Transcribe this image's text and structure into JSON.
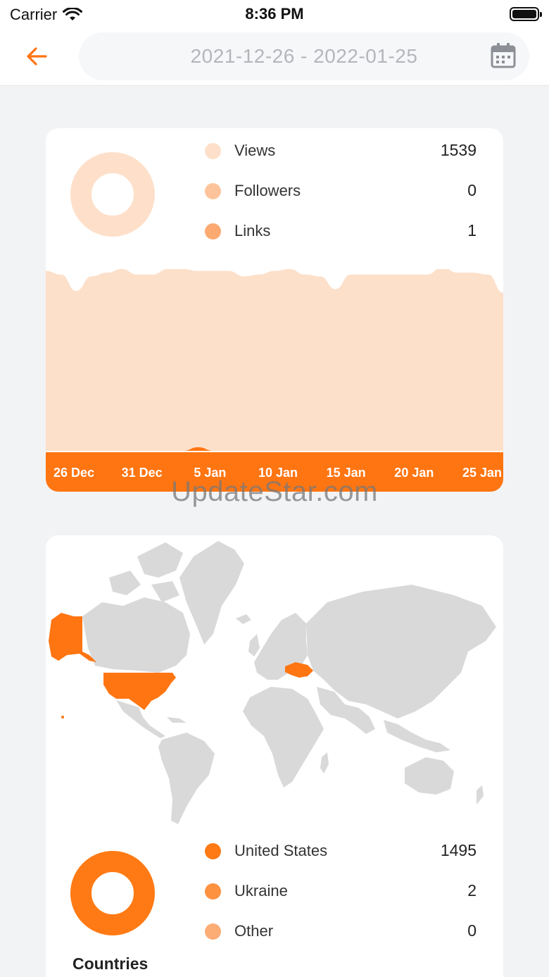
{
  "status_bar": {
    "carrier": "Carrier",
    "time": "8:36 PM"
  },
  "header": {
    "date_range": "2021-12-26 - 2022-01-25"
  },
  "stats": [
    {
      "label": "Views",
      "value": "1539",
      "color": "#fee0ca"
    },
    {
      "label": "Followers",
      "value": "0",
      "color": "#fdc49b"
    },
    {
      "label": "Links",
      "value": "1",
      "color": "#fcaa72"
    }
  ],
  "chart_data": {
    "type": "area",
    "x": [
      "26 Dec",
      "27 Dec",
      "28 Dec",
      "29 Dec",
      "30 Dec",
      "31 Dec",
      "1 Jan",
      "2 Jan",
      "3 Jan",
      "4 Jan",
      "5 Jan",
      "6 Jan",
      "7 Jan",
      "8 Jan",
      "9 Jan",
      "10 Jan",
      "11 Jan",
      "12 Jan",
      "13 Jan",
      "14 Jan",
      "15 Jan",
      "16 Jan",
      "17 Jan",
      "18 Jan",
      "19 Jan",
      "20 Jan",
      "21 Jan",
      "22 Jan",
      "23 Jan",
      "24 Jan",
      "25 Jan"
    ],
    "tick_labels": [
      "26 Dec",
      "31 Dec",
      "5 Jan",
      "10 Jan",
      "15 Jan",
      "20 Jan",
      "25 Jan"
    ],
    "series": [
      {
        "values": [
          99,
          97,
          88,
          96,
          98,
          100,
          97,
          97,
          100,
          100,
          99,
          99,
          99,
          96,
          97,
          99,
          100,
          97,
          96,
          89,
          97,
          97,
          97,
          97,
          97,
          97,
          101,
          98,
          98,
          97,
          87
        ],
        "color": "#fde0ca"
      },
      {
        "values": [
          0,
          0,
          0,
          0,
          0,
          0,
          0,
          0,
          0,
          0,
          2,
          0,
          0,
          0,
          0,
          0,
          0,
          0,
          0,
          0,
          0,
          0,
          0,
          0,
          0,
          0,
          0,
          0,
          0,
          0,
          0
        ],
        "color": "#ff7512"
      }
    ],
    "ylim": [
      0,
      100
    ]
  },
  "countries": [
    {
      "label": "United States",
      "value": "1495",
      "color": "#ff7a14"
    },
    {
      "label": "Ukraine",
      "value": "2",
      "color": "#fd9240"
    },
    {
      "label": "Other",
      "value": "0",
      "color": "#fcac75"
    }
  ],
  "countries_title": "Countries",
  "watermark": "UpdateStar.com",
  "colors": {
    "accent": "#ff7512",
    "map_land": "#d9d9d9",
    "map_highlight": "#ff7512"
  }
}
